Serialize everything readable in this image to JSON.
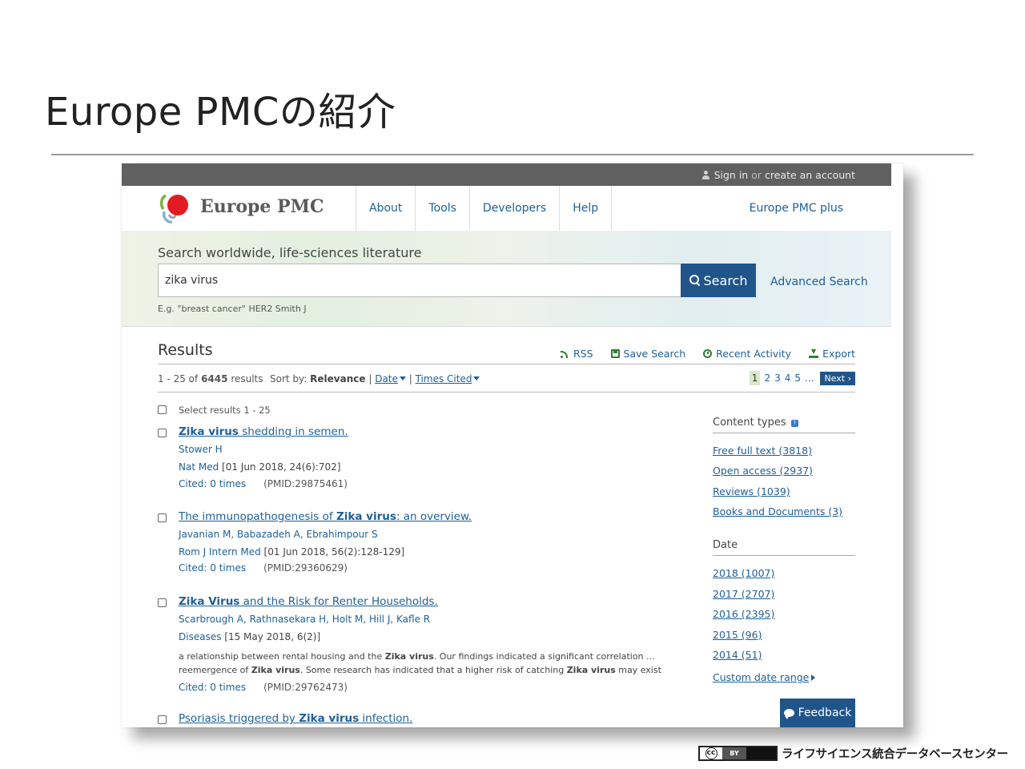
{
  "slide": {
    "title": "Europe PMCの紹介"
  },
  "topbar": {
    "signin": "Sign in",
    "or": "or",
    "create": "create an account"
  },
  "header": {
    "logo_text": "Europe PMC",
    "nav": [
      "About",
      "Tools",
      "Developers",
      "Help"
    ],
    "plus_link": "Europe PMC plus"
  },
  "search": {
    "heading": "Search worldwide, life-sciences literature",
    "value": "zika virus",
    "button_label": "Search",
    "advanced_label": "Advanced Search",
    "hint": "E.g. \"breast cancer\" HER2 Smith J"
  },
  "results": {
    "heading": "Results",
    "tools": {
      "rss": "RSS",
      "save": "Save Search",
      "recent": "Recent Activity",
      "export": "Export"
    },
    "count": {
      "range": "1 - 25 of",
      "total": "6445",
      "suffix": "results"
    },
    "sort": {
      "label": "Sort by:",
      "current": "Relevance",
      "sep": "|",
      "date": "Date",
      "cited": "Times Cited"
    },
    "pager": {
      "pages": [
        "1",
        "2",
        "3",
        "4",
        "5"
      ],
      "ellipsis": "...",
      "next": "Next"
    },
    "select_all": "Select results 1 - 25",
    "items": [
      {
        "title_bold": "Zika virus",
        "title_rest": " shedding in semen.",
        "authors": "Stower H",
        "journal": "Nat Med",
        "journal_detail": " [01 Jun 2018, 24(6):702]",
        "cited": "Cited: 0 times",
        "pmid": "(PMID:29875461)"
      },
      {
        "title_pre": "The immunopathogenesis of ",
        "title_bold": "Zika virus",
        "title_rest": ": an overview.",
        "authors": "Javanian M, Babazadeh A, Ebrahimpour S",
        "journal": "Rom J Intern Med",
        "journal_detail": " [01 Jun 2018, 56(2):128-129]",
        "cited": "Cited: 0 times",
        "pmid": "(PMID:29360629)"
      },
      {
        "title_bold": "Zika Virus",
        "title_rest": " and the Risk for Renter Households.",
        "authors": "Scarbrough A, Rathnasekara H, Holt M, Hill J, Kafle R",
        "journal": "Diseases",
        "journal_detail": " [15 May 2018, 6(2)]",
        "snippet1_pre": "a relationship between rental housing and the ",
        "snippet1_bold": "Zika virus",
        "snippet1_post": ". Our findings indicated a significant correlation ...",
        "snippet2_pre": "reemergence of ",
        "snippet2_bold": "Zika virus",
        "snippet2_mid": ". Some research has indicated that a higher risk of catching ",
        "snippet2_bold2": "Zika virus",
        "snippet2_post": " may exist",
        "cited": "Cited: 0 times",
        "pmid": "(PMID:29762473)"
      },
      {
        "title_pre": "Psoriasis triggered by ",
        "title_bold": "Zika virus",
        "title_rest": " infection."
      }
    ]
  },
  "facets": {
    "content_types": {
      "heading": "Content types",
      "help_icon": "question-icon",
      "links": [
        "Free full text (3818)",
        "Open access (2937)",
        "Reviews (1039)",
        "Books and Documents (3)"
      ]
    },
    "date": {
      "heading": "Date",
      "links": [
        "2018 (1007)",
        "2017 (2707)",
        "2016 (2395)",
        "2015 (96)",
        "2014 (51)"
      ],
      "custom": "Custom date range"
    }
  },
  "feedback": {
    "label": "Feedback"
  },
  "footer": {
    "license_cc": "cc",
    "license_by": "BY",
    "organization": "ライフサイエンス統合データベースセンター"
  },
  "colors": {
    "brand_blue": "#20558a",
    "link_blue": "#1e5f99",
    "topbar_gray": "#606060",
    "icon_green": "#2e7d32",
    "logo_red": "#e31b23"
  }
}
